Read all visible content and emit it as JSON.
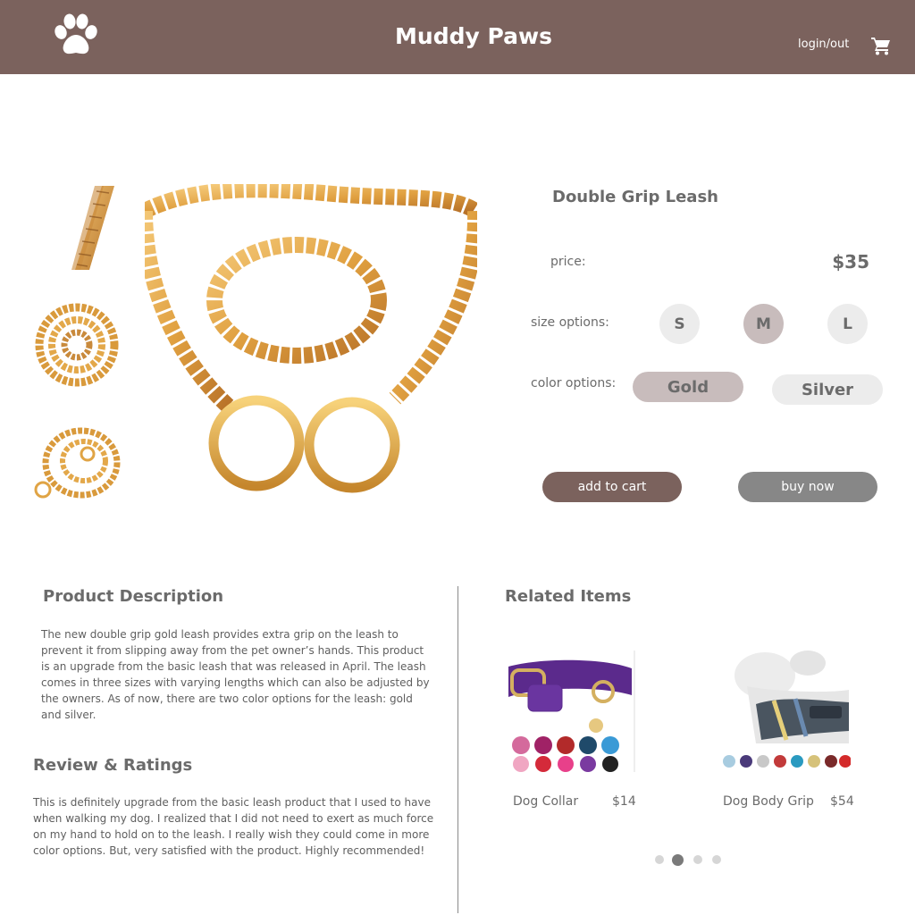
{
  "header": {
    "brand": "Muddy Paws",
    "login_label": "login/out",
    "logo_icon": "paw-print-icon",
    "cart_icon": "shopping-cart-icon",
    "background_color": "#7b625d"
  },
  "product": {
    "title": "Double Grip Leash",
    "price_label": "price:",
    "price": "$35",
    "size_label": "size options:",
    "sizes": [
      "S",
      "M",
      "L"
    ],
    "selected_size": "M",
    "color_label": "color options:",
    "colors": [
      "Gold",
      "Silver"
    ],
    "selected_color": "Gold",
    "add_to_cart": "add to cart",
    "buy_now": "buy now"
  },
  "description": {
    "title": "Product Description",
    "text": "The new double grip gold leash provides extra grip on the leash to prevent it from slipping away from the pet owner’s hands. This product is an upgrade from the basic leash that was released in April. The leash comes in three sizes with varying lengths which can also be adjusted by the owners. As of now, there are two color options for the leash: gold and silver."
  },
  "review": {
    "title": "Review & Ratings",
    "text": "This is definitely upgrade from the basic leash product that I used to have when walking my dog. I realized that I did not need to exert as much force on my hand to hold on to the leash. I really wish they could come in more color options. But, very satisfied with the product. Highly recommended!"
  },
  "related": {
    "title": "Related Items",
    "items": [
      {
        "name": "Dog Collar",
        "price": "$14"
      },
      {
        "name": "Dog Body Grip",
        "price": "$54"
      }
    ],
    "carousel_pages": 4,
    "carousel_active": 2
  },
  "colors": {
    "accent": "#7b625d",
    "selected_option": "#c8bcbc",
    "unselected_option": "#ececec",
    "buy_now": "#878787",
    "gold_chain": "#d99a3c"
  }
}
